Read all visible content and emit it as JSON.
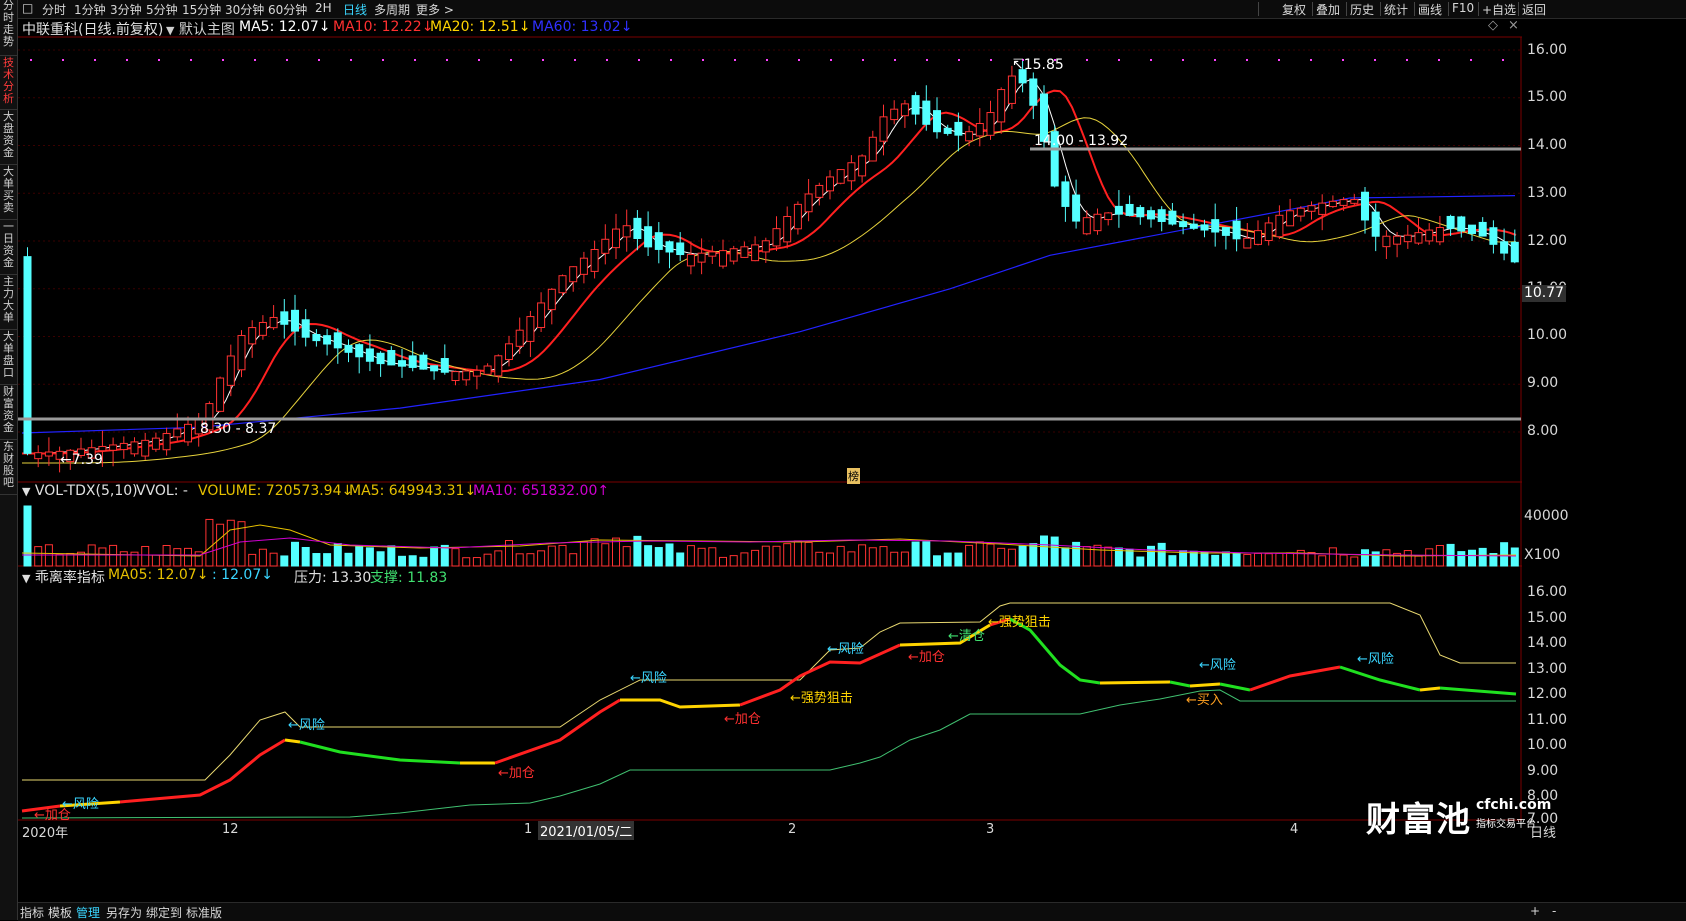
{
  "sidebar": {
    "tabs": [
      {
        "id": "fenshi",
        "label": "分时走势",
        "active": false
      },
      {
        "id": "jishu",
        "label": "技术分析",
        "active": true
      },
      {
        "id": "dapan",
        "label": "大盘资金",
        "active": false
      },
      {
        "id": "dadan",
        "label": "大单买卖",
        "active": false
      },
      {
        "id": "yiri",
        "label": "一日资金",
        "active": false
      },
      {
        "id": "zhuli",
        "label": "主力大单",
        "active": false
      },
      {
        "id": "pankou",
        "label": "大单盘口",
        "active": false
      },
      {
        "id": "caifu",
        "label": "财富资金",
        "active": false
      },
      {
        "id": "dongcai",
        "label": "东财股吧",
        "active": false
      }
    ]
  },
  "topbar": {
    "periods": [
      "分时",
      "1分钟",
      "3分钟",
      "5分钟",
      "15分钟",
      "30分钟",
      "60分钟",
      "2H",
      "日线",
      "多周期",
      "更多 >"
    ],
    "active_period": "日线",
    "right_items": [
      "复权",
      "叠加",
      "历史",
      "统计",
      "画线",
      "F10",
      "+自选",
      "返回"
    ]
  },
  "main_header": {
    "stock_name": "中联重科(日线.前复权)",
    "template": "默认主图",
    "ma5": "MA5: 12.07↓",
    "ma10": "MA10: 12.22↓",
    "ma20": "MA20: 12.51↓",
    "ma60": "MA60: 13.02↓"
  },
  "main_chart": {
    "price_ticks": [
      "16.00",
      "15.00",
      "14.00",
      "13.00",
      "12.00",
      "11.00",
      "10.00",
      "9.00",
      "8.00"
    ],
    "current_price": "10.77",
    "annotations": {
      "high": "15.85",
      "low": "7.39",
      "range_a": "8.30 - 8.37",
      "range_b": "14.00 - 13.92",
      "bang": "榜"
    }
  },
  "volume_header": {
    "name": "VOL-TDX(5,10)",
    "vvol": "VVOL: -",
    "volume": "VOLUME: 720573.94↓",
    "ma5": "MA5: 649943.31↓",
    "ma10": "MA10: 651832.00↑"
  },
  "volume_chart": {
    "ticks": [
      "40000",
      "X100"
    ]
  },
  "indicator_header": {
    "name": "乖离率指标",
    "ma05": "MA05: 12.07↓",
    "blank": ": 12.07↓",
    "pressure": "压力: 13.30",
    "support": "支撑: 11.83"
  },
  "indicator_chart": {
    "ticks": [
      "16.00",
      "15.00",
      "14.00",
      "13.00",
      "12.00",
      "11.00",
      "10.00",
      "9.00",
      "8.00",
      "7.00"
    ],
    "signals": {
      "jiacang_1": "←加仓",
      "fengxian_1": "←风险",
      "fengxian_2": "←风险",
      "jiacang_2": "←加仓",
      "fengxian_3": "←风险",
      "jiacang_3": "←加仓",
      "qiangshi_1": "←强势狙击",
      "fengxian_4": "←风险",
      "jiacang_4": "←加仓",
      "qingcang": "←清仓",
      "qiangshi_2": "←强势狙击",
      "fengxian_5": "←风险",
      "mairu": "←买入",
      "fengxian_6": "←风险"
    }
  },
  "date_axis": {
    "labels": [
      "2020年",
      "12",
      "1",
      "2021/01/05/二",
      "2",
      "3",
      "4",
      "日线"
    ]
  },
  "watermark": {
    "brand": "财富池",
    "site": "cfchi.com",
    "tagline": "指标交易平台"
  },
  "bottombar": {
    "items": [
      "指标",
      "模板",
      "管理",
      "另存为",
      "绑定到",
      "标准版"
    ],
    "active": "管理",
    "right": [
      "+",
      "-"
    ]
  },
  "colors": {
    "up": "#ff3232",
    "down": "#54ffff",
    "ma5": "#ffffff",
    "ma10": "#ff2020",
    "ma20": "#e6d23c",
    "ma60": "#2222ff",
    "grid": "#3a0000"
  }
}
